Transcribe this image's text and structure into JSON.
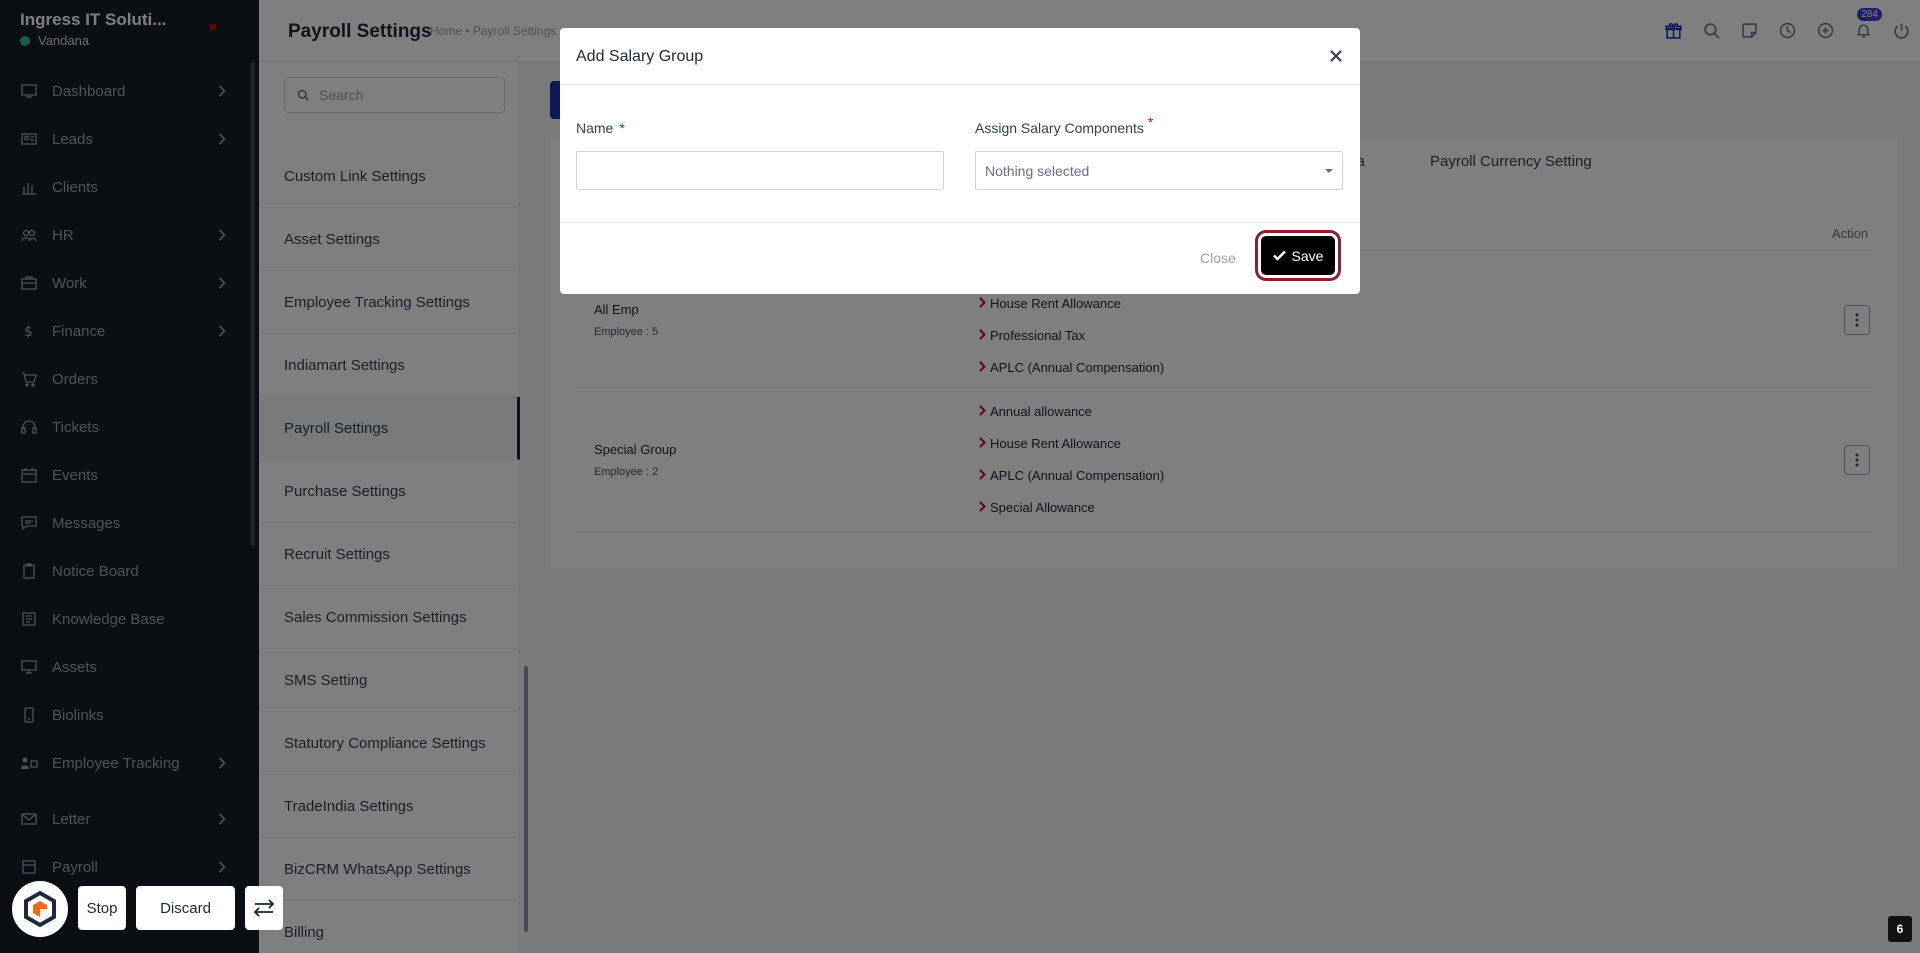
{
  "sidebar": {
    "company": "Ingress IT Soluti...",
    "user": "Vandana",
    "nav": [
      {
        "label": "Dashboard",
        "icon": "dashboard-icon",
        "has_children": true
      },
      {
        "label": "Leads",
        "icon": "leads-icon",
        "has_children": true
      },
      {
        "label": "Clients",
        "icon": "clients-icon",
        "has_children": false
      },
      {
        "label": "HR",
        "icon": "hr-icon",
        "has_children": true
      },
      {
        "label": "Work",
        "icon": "work-icon",
        "has_children": true
      },
      {
        "label": "Finance",
        "icon": "finance-icon",
        "has_children": true
      },
      {
        "label": "Orders",
        "icon": "orders-icon",
        "has_children": false
      },
      {
        "label": "Tickets",
        "icon": "tickets-icon",
        "has_children": false
      },
      {
        "label": "Events",
        "icon": "events-icon",
        "has_children": false
      },
      {
        "label": "Messages",
        "icon": "messages-icon",
        "has_children": false
      },
      {
        "label": "Notice Board",
        "icon": "notice-board-icon",
        "has_children": false
      },
      {
        "label": "Knowledge Base",
        "icon": "knowledge-base-icon",
        "has_children": false
      },
      {
        "label": "Assets",
        "icon": "assets-icon",
        "has_children": false
      },
      {
        "label": "Biolinks",
        "icon": "biolinks-icon",
        "has_children": false
      },
      {
        "label": "Employee Tracking",
        "icon": "employee-tracking-icon",
        "has_children": true
      },
      {
        "label": "Letter",
        "icon": "letter-icon",
        "has_children": true
      },
      {
        "label": "Payroll",
        "icon": "payroll-icon",
        "has_children": true
      }
    ]
  },
  "header": {
    "title": "Payroll Settings",
    "breadcrumb": "Home • Payroll Settings",
    "notification_count": "284"
  },
  "settings_menu": {
    "search_placeholder": "Search",
    "items": [
      "Custom Link Settings",
      "Asset Settings",
      "Employee Tracking Settings",
      "Indiamart Settings",
      "Payroll Settings",
      "Purchase Settings",
      "Recruit Settings",
      "Sales Commission Settings",
      "SMS Setting",
      "Statutory Compliance Settings",
      "TradeIndia Settings",
      "BizCRM WhatsApp Settings",
      "Billing"
    ],
    "active_index": 4
  },
  "main": {
    "tabs": [
      "ata",
      "Payroll Currency Setting"
    ],
    "action_header": "Action",
    "groups": [
      {
        "name": "All Emp",
        "employees": "Employee : 5",
        "components": [
          "House Rent Allowance",
          "Professional Tax",
          "APLC (Annual Compensation)"
        ]
      },
      {
        "name": "Special Group",
        "employees": "Employee : 2",
        "components": [
          "Annual allowance",
          "House Rent Allowance",
          "APLC (Annual Compensation)",
          "Special Allowance"
        ]
      }
    ]
  },
  "modal": {
    "title": "Add Salary Group",
    "name_label": "Name",
    "name_value": "",
    "components_label": "Assign Salary Components",
    "components_value": "Nothing selected",
    "required_mark": "*",
    "close_label": "Close",
    "save_label": "Save"
  },
  "recorder": {
    "stop_label": "Stop",
    "discard_label": "Discard"
  },
  "page_number": "6",
  "colors": {
    "sidebar_bg": "#171f29",
    "primary": "#1d2eae",
    "required": "#d0021b",
    "save_bg": "#000000",
    "save_ring": "#8b1e2f"
  }
}
